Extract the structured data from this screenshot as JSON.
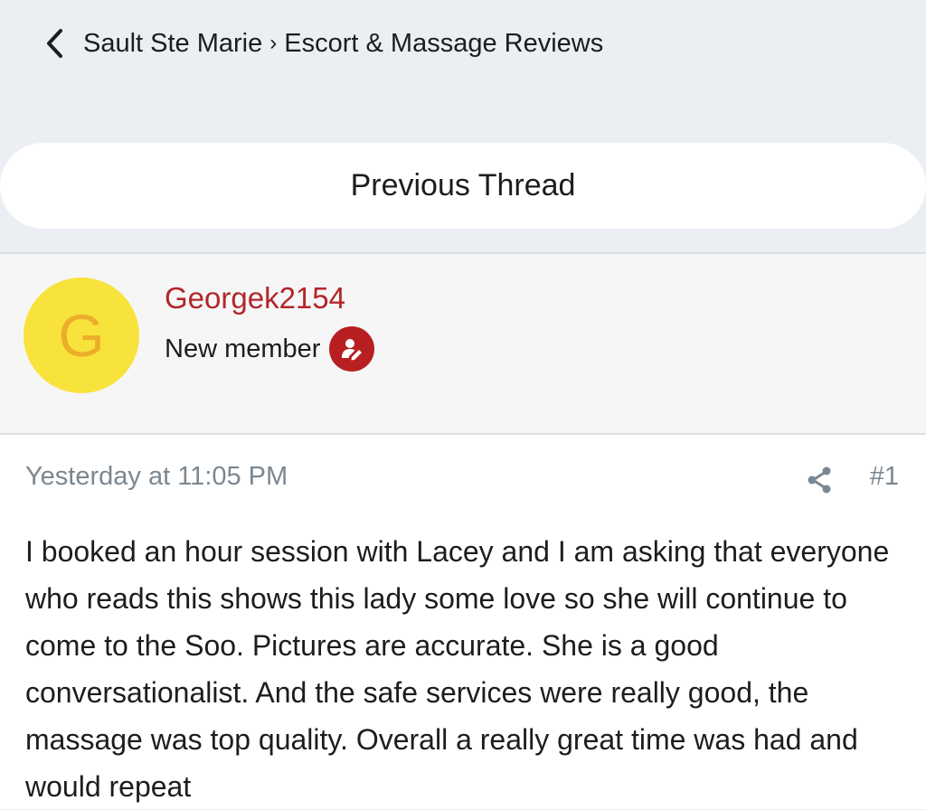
{
  "header": {
    "breadcrumb_forum": "Sault Ste Marie",
    "breadcrumb_separator": "›",
    "breadcrumb_subforum": "Escort & Massage Reviews",
    "back_icon": "chevron-left-icon"
  },
  "navigation": {
    "previous_thread_label": "Previous Thread"
  },
  "user": {
    "avatar_letter": "G",
    "avatar_color": "#f8e33c",
    "avatar_letter_color": "#ecae2a",
    "username": "Georgek2154",
    "username_color": "#b3262a",
    "title": "New member",
    "badge_icon": "user-edit-icon",
    "badge_color": "#b81f23"
  },
  "post": {
    "timestamp": "Yesterday at 11:05 PM",
    "share_icon": "share-icon",
    "number": "#1",
    "body": "I booked an hour session with Lacey and I am asking that everyone who reads this shows this lady some love so she will continue to come to the Soo. Pictures are accurate. She is a good conversationalist. And the safe services were really good, the massage was top quality. Overall a really great time was had and would repeat"
  }
}
